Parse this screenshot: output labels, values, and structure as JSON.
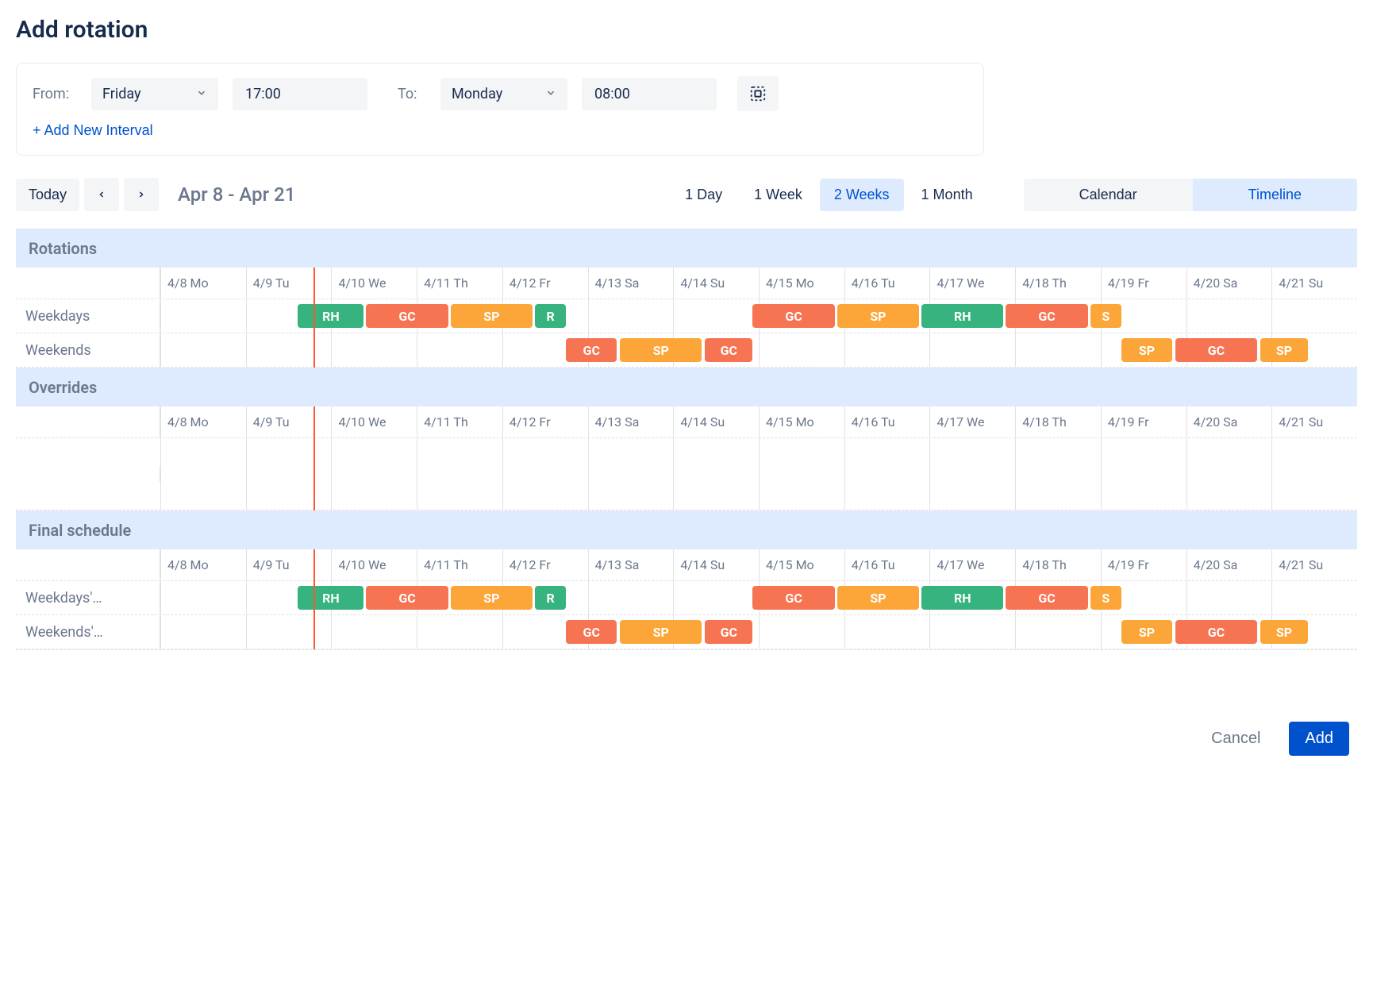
{
  "title": "Add rotation",
  "interval": {
    "from_label": "From:",
    "from_day": "Friday",
    "from_time": "17:00",
    "to_label": "To:",
    "to_day": "Monday",
    "to_time": "08:00",
    "add_new_label": "+ Add New Interval"
  },
  "toolbar": {
    "today": "Today",
    "range": "Apr 8 - Apr 21",
    "ranges": {
      "day": "1 Day",
      "week": "1 Week",
      "two_weeks": "2 Weeks",
      "month": "1 Month",
      "active": "two_weeks"
    },
    "views": {
      "calendar": "Calendar",
      "timeline": "Timeline",
      "active": "timeline"
    }
  },
  "colors": {
    "RH": "green",
    "GC": "orange",
    "SP": "amber",
    "R": "green",
    "S": "amber"
  },
  "now_marker_pct": 12.8,
  "dates": [
    "4/8 Mo",
    "4/9 Tu",
    "4/10 We",
    "4/11 Th",
    "4/12 Fr",
    "4/13 Sa",
    "4/14 Su",
    "4/15 Mo",
    "4/16 Tu",
    "4/17 We",
    "4/18 Th",
    "4/19 Fr",
    "4/20 Sa",
    "4/21 Su"
  ],
  "sections": [
    {
      "title": "Rotations",
      "show_dates": true,
      "tracks": [
        {
          "label": "Weekdays",
          "bars": [
            {
              "text": "RH",
              "color": "green",
              "start": 11.5,
              "width": 5.5
            },
            {
              "text": "GC",
              "color": "orange",
              "start": 17.2,
              "width": 6.85
            },
            {
              "text": "SP",
              "color": "amber",
              "start": 24.25,
              "width": 6.85
            },
            {
              "text": "R",
              "color": "green",
              "start": 31.3,
              "width": 2.6
            },
            {
              "text": "GC",
              "color": "orange",
              "start": 49.5,
              "width": 6.85
            },
            {
              "text": "SP",
              "color": "amber",
              "start": 56.55,
              "width": 6.85
            },
            {
              "text": "RH",
              "color": "green",
              "start": 63.6,
              "width": 6.85
            },
            {
              "text": "GC",
              "color": "orange",
              "start": 70.65,
              "width": 6.85
            },
            {
              "text": "S",
              "color": "amber",
              "start": 77.7,
              "width": 2.6
            }
          ]
        },
        {
          "label": "Weekends",
          "bars": [
            {
              "text": "GC",
              "color": "orange",
              "start": 33.9,
              "width": 4.25
            },
            {
              "text": "SP",
              "color": "amber",
              "start": 38.4,
              "width": 6.85
            },
            {
              "text": "GC",
              "color": "orange",
              "start": 45.5,
              "width": 4.0
            },
            {
              "text": "SP",
              "color": "amber",
              "start": 80.3,
              "width": 4.25
            },
            {
              "text": "GC",
              "color": "orange",
              "start": 84.8,
              "width": 6.85
            },
            {
              "text": "SP",
              "color": "amber",
              "start": 91.9,
              "width": 4.0
            }
          ]
        }
      ]
    },
    {
      "title": "Overrides",
      "show_dates": true,
      "tracks": [
        {
          "label": "",
          "bars": [],
          "empty": true
        }
      ]
    },
    {
      "title": "Final schedule",
      "show_dates": true,
      "tracks": [
        {
          "label": "Weekdays'…",
          "bars": [
            {
              "text": "RH",
              "color": "green",
              "start": 11.5,
              "width": 5.5
            },
            {
              "text": "GC",
              "color": "orange",
              "start": 17.2,
              "width": 6.85
            },
            {
              "text": "SP",
              "color": "amber",
              "start": 24.25,
              "width": 6.85
            },
            {
              "text": "R",
              "color": "green",
              "start": 31.3,
              "width": 2.6
            },
            {
              "text": "GC",
              "color": "orange",
              "start": 49.5,
              "width": 6.85
            },
            {
              "text": "SP",
              "color": "amber",
              "start": 56.55,
              "width": 6.85
            },
            {
              "text": "RH",
              "color": "green",
              "start": 63.6,
              "width": 6.85
            },
            {
              "text": "GC",
              "color": "orange",
              "start": 70.65,
              "width": 6.85
            },
            {
              "text": "S",
              "color": "amber",
              "start": 77.7,
              "width": 2.6
            }
          ]
        },
        {
          "label": "Weekends'…",
          "bars": [
            {
              "text": "GC",
              "color": "orange",
              "start": 33.9,
              "width": 4.25
            },
            {
              "text": "SP",
              "color": "amber",
              "start": 38.4,
              "width": 6.85
            },
            {
              "text": "GC",
              "color": "orange",
              "start": 45.5,
              "width": 4.0
            },
            {
              "text": "SP",
              "color": "amber",
              "start": 80.3,
              "width": 4.25
            },
            {
              "text": "GC",
              "color": "orange",
              "start": 84.8,
              "width": 6.85
            },
            {
              "text": "SP",
              "color": "amber",
              "start": 91.9,
              "width": 4.0
            }
          ]
        }
      ]
    }
  ],
  "footer": {
    "cancel": "Cancel",
    "add": "Add"
  }
}
